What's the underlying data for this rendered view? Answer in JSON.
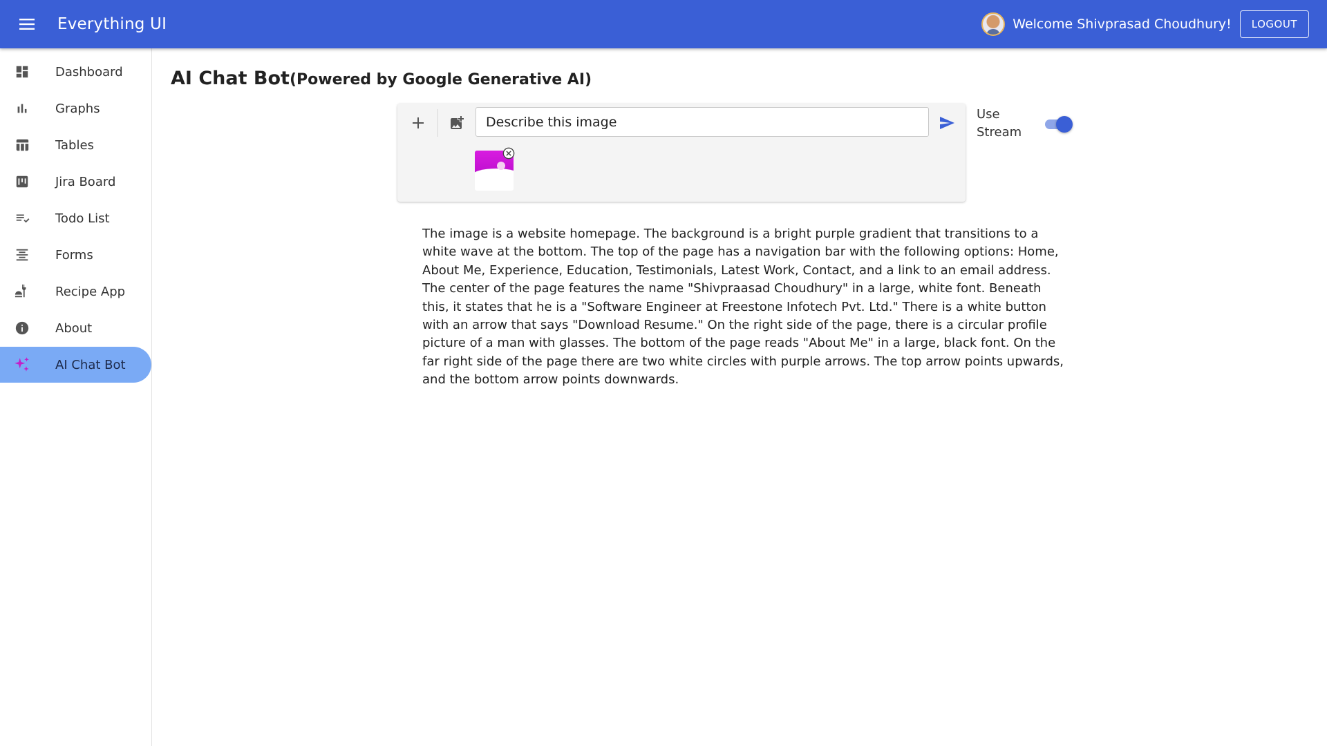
{
  "app": {
    "title": "Everything UI",
    "welcome": "Welcome Shivprasad Choudhury!",
    "logout_label": "LOGOUT"
  },
  "sidebar": {
    "items": [
      {
        "label": "Dashboard",
        "icon": "dashboard-icon"
      },
      {
        "label": "Graphs",
        "icon": "bar-chart-icon"
      },
      {
        "label": "Tables",
        "icon": "table-icon"
      },
      {
        "label": "Jira Board",
        "icon": "kanban-icon"
      },
      {
        "label": "Todo List",
        "icon": "checklist-icon"
      },
      {
        "label": "Forms",
        "icon": "align-center-icon"
      },
      {
        "label": "Recipe App",
        "icon": "food-icon"
      },
      {
        "label": "About",
        "icon": "info-icon"
      },
      {
        "label": "AI Chat Bot",
        "icon": "sparkle-icon",
        "active": true
      }
    ]
  },
  "main": {
    "title": "AI Chat Bot",
    "subtitle": "(Powered by Google Generative AI)",
    "prompt_value": "Describe this image",
    "stream_label": "Use Stream",
    "stream_enabled": true,
    "response": "The image is a website homepage. The background is a bright purple gradient that transitions to a white wave at the bottom. The top of the page has a navigation bar with the following options: Home, About Me, Experience, Education, Testimonials, Latest Work, Contact, and a link to an email address. The center of the page features the name \"Shivpraasad Choudhury\" in a large, white font. Beneath this, it states that he is a \"Software Engineer at Freestone Infotech Pvt. Ltd.\" There is a white button with an arrow that says \"Download Resume.\" On the right side of the page, there is a circular profile picture of a man with glasses. The bottom of the page reads \"About Me\" in a large, black font. On the far right side of the page there are two white circles with purple arrows. The top arrow points upwards, and the bottom arrow points downwards."
  },
  "colors": {
    "primary": "#3a5fd6",
    "active_nav": "#7aaaf5",
    "sparkle": "#c21fc9"
  }
}
